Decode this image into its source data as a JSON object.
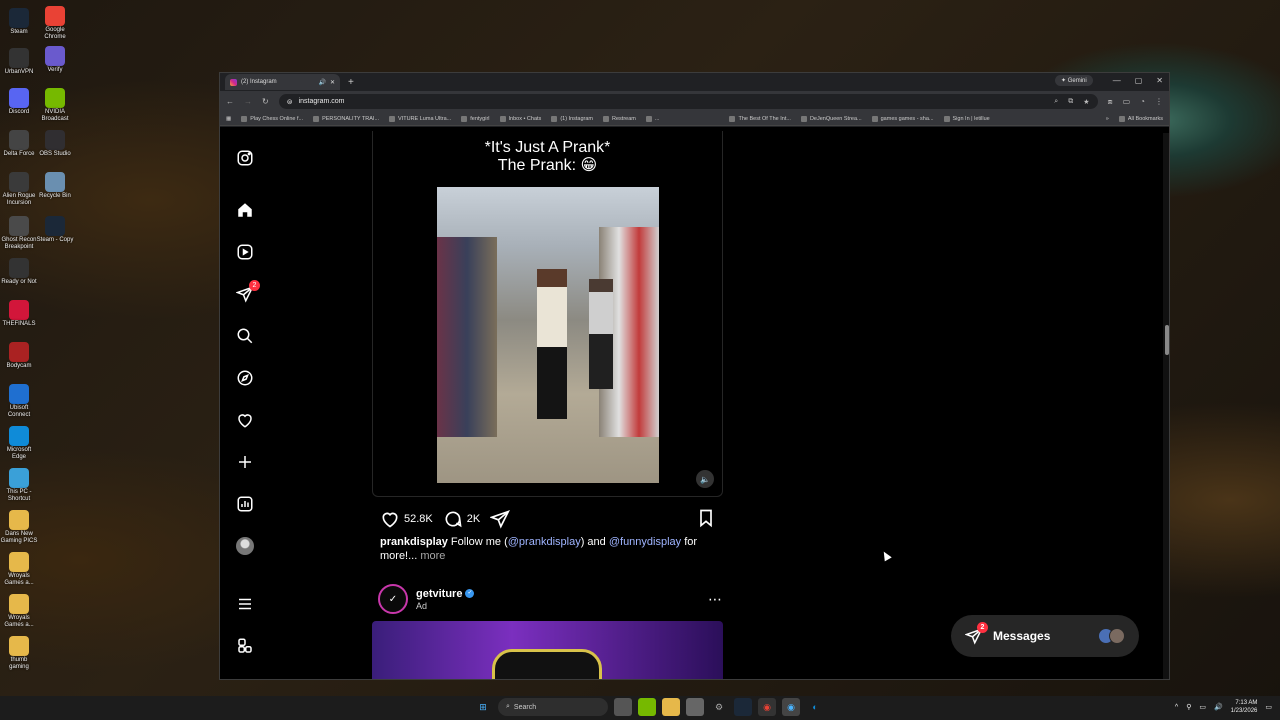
{
  "desktop": {
    "icons": [
      {
        "label": "Steam",
        "color": "#1b2838"
      },
      {
        "label": "Google Chrome",
        "color": "#e94235"
      },
      {
        "label": "UrbanVPN",
        "color": "#333"
      },
      {
        "label": "Verify",
        "color": "#6a5acd"
      },
      {
        "label": "Discord",
        "color": "#5865f2"
      },
      {
        "label": "NVIDIA Broadcast",
        "color": "#76b900"
      },
      {
        "label": "Delta Force",
        "color": "#444"
      },
      {
        "label": "OBS Studio",
        "color": "#302e31"
      },
      {
        "label": "Alien Rogue Incursion",
        "color": "#3a3a3a"
      },
      {
        "label": "Recycle Bin",
        "color": "#6a8fb0"
      },
      {
        "label": "Ghost Recon Breakpoint",
        "color": "#4a4a4a"
      },
      {
        "label": "Steam - Copy",
        "color": "#1b2838"
      },
      {
        "label": "Ready or Not",
        "color": "#333"
      },
      {
        "label": "THEFINALS",
        "color": "#d2163a"
      },
      {
        "label": "Bodycam",
        "color": "#a22"
      },
      {
        "label": "Ubisoft Connect",
        "color": "#1f6fd0"
      },
      {
        "label": "Microsoft Edge",
        "color": "#0f8bd8"
      },
      {
        "label": "This PC - Shortcut",
        "color": "#3aa0d8"
      },
      {
        "label": "Dans New Gaming PICS",
        "color": "#e6b84a"
      },
      {
        "label": "Wroyals Games a...",
        "color": "#e6b84a"
      },
      {
        "label": "Wroyals Games a...",
        "color": "#e6b84a"
      },
      {
        "label": "thumb gaming",
        "color": "#e6b84a"
      }
    ]
  },
  "browser": {
    "tab_title": "(2) Instagram",
    "gemini_label": "Gemini",
    "url": "instagram.com",
    "bookmarks": [
      "Play Chess Online f...",
      "PERSONALITY TRAI...",
      "VITURE Luma Ultra...",
      "fentygirl",
      "Inbox • Chats",
      "(1) Instagram",
      "Restream",
      "...",
      "The Best Of The Int...",
      "DeJenQueen Strea...",
      "games games - sha...",
      "Sign In | letillue"
    ],
    "all_bookmarks": "All Bookmarks"
  },
  "instagram": {
    "sidebar_badge": "2",
    "post": {
      "title_line1": "*It's Just A Prank*",
      "title_line2": "The Prank: 😁",
      "likes": "52.8K",
      "comments": "2K",
      "caption_user": "prankdisplay",
      "caption_text1": " Follow me (",
      "mention1": "@prankdisplay",
      "caption_text2": ") and ",
      "mention2": "@funnydisplay",
      "caption_text3": " for more!...",
      "more": " more"
    },
    "ad": {
      "username": "getviture",
      "label": "Ad",
      "more_icon": "⋯"
    },
    "messages": {
      "label": "Messages",
      "badge": "2"
    }
  },
  "taskbar": {
    "search_placeholder": "Search",
    "time": "7:13 AM",
    "date": "1/23/2026"
  }
}
